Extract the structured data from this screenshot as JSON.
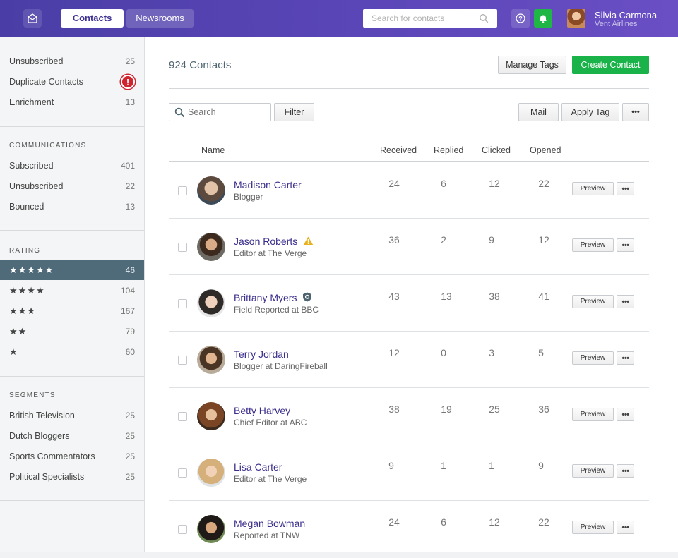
{
  "nav": {
    "tabs": [
      {
        "label": "Contacts",
        "active": true
      },
      {
        "label": "Newsrooms",
        "active": false
      }
    ],
    "search_placeholder": "Search for contacts",
    "icons": [
      "mail-logo-icon",
      "search-icon",
      "help-icon",
      "bell-icon"
    ],
    "user": {
      "name": "Silvia Carmona",
      "company": "Vent Airlines"
    }
  },
  "sidebar": {
    "top": [
      {
        "label": "Unsubscribed",
        "count": "25"
      },
      {
        "label": "Duplicate Contacts",
        "badge": "!"
      },
      {
        "label": "Enrichment",
        "count": "13"
      }
    ],
    "communications": {
      "heading": "COMMUNICATIONS",
      "items": [
        {
          "label": "Subscribed",
          "count": "401"
        },
        {
          "label": "Unsubscribed",
          "count": "22"
        },
        {
          "label": "Bounced",
          "count": "13"
        }
      ]
    },
    "rating": {
      "heading": "RATING",
      "items": [
        {
          "label": "★★★★★",
          "count": "46",
          "active": true
        },
        {
          "label": "★★★★",
          "count": "104"
        },
        {
          "label": "★★★",
          "count": "167"
        },
        {
          "label": "★★",
          "count": "79"
        },
        {
          "label": "★",
          "count": "60"
        }
      ]
    },
    "segments": {
      "heading": "SEGMENTS",
      "items": [
        {
          "label": "British Television",
          "count": "25"
        },
        {
          "label": "Dutch Bloggers",
          "count": "25"
        },
        {
          "label": "Sports Commentators",
          "count": "25"
        },
        {
          "label": "Political Specialists",
          "count": "25"
        }
      ]
    }
  },
  "main": {
    "title": "924 Contacts",
    "manage_tags": "Manage Tags",
    "create_contact": "Create Contact",
    "search_placeholder": "Search",
    "filter": "Filter",
    "mail": "Mail",
    "apply_tag": "Apply Tag",
    "more": "•••",
    "columns": {
      "name": "Name",
      "received": "Received",
      "replied": "Replied",
      "clicked": "Clicked",
      "opened": "Opened"
    },
    "preview_label": "Preview",
    "row_more": "•••",
    "contacts": [
      {
        "name": "Madison Carter",
        "role": "Blogger",
        "received": "24",
        "replied": "6",
        "clicked": "12",
        "opened": "22",
        "flag": ""
      },
      {
        "name": "Jason Roberts",
        "role": "Editor at The Verge",
        "received": "36",
        "replied": "2",
        "clicked": "9",
        "opened": "12",
        "flag": "warning"
      },
      {
        "name": "Brittany Myers",
        "role": "Field Reported at BBC",
        "received": "43",
        "replied": "13",
        "clicked": "38",
        "opened": "41",
        "flag": "verified"
      },
      {
        "name": "Terry Jordan",
        "role": "Blogger at DaringFireball",
        "received": "12",
        "replied": "0",
        "clicked": "3",
        "opened": "5",
        "flag": ""
      },
      {
        "name": "Betty Harvey",
        "role": "Chief Editor at ABC",
        "received": "38",
        "replied": "19",
        "clicked": "25",
        "opened": "36",
        "flag": ""
      },
      {
        "name": "Lisa Carter",
        "role": "Editor at The Verge",
        "received": "9",
        "replied": "1",
        "clicked": "1",
        "opened": "9",
        "flag": ""
      },
      {
        "name": "Megan Bowman",
        "role": "Reported at TNW",
        "received": "24",
        "replied": "6",
        "clicked": "12",
        "opened": "22",
        "flag": ""
      }
    ]
  },
  "colors": {
    "accent": "#3a2e8c",
    "create": "#1ab34a",
    "active_rating": "#4f6b79",
    "alert": "#d0242f"
  }
}
